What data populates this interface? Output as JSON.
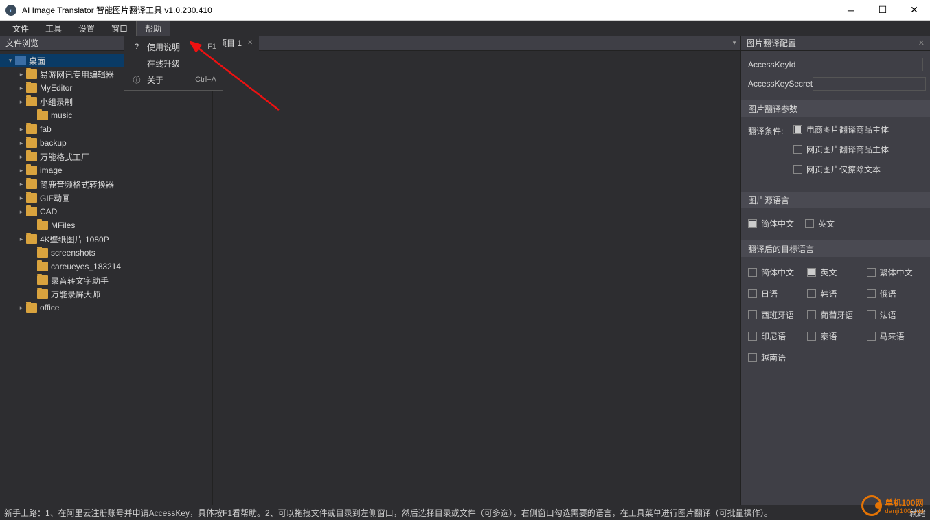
{
  "title": "AI Image Translator 智能图片翻译工具 v1.0.230.410",
  "menu": {
    "items": [
      "文件",
      "工具",
      "设置",
      "窗口",
      "帮助"
    ],
    "active": 4
  },
  "help_menu": [
    {
      "icon": "?",
      "label": "使用说明",
      "shortcut": "F1"
    },
    {
      "icon": "",
      "label": "在线升级",
      "shortcut": ""
    },
    {
      "icon": "ⓘ",
      "label": "关于",
      "shortcut": "Ctrl+A"
    }
  ],
  "left_panel_title": "文件浏览",
  "tree": [
    {
      "d": 0,
      "exp": "▾",
      "ico": "desktop",
      "lbl": "桌面",
      "sel": true
    },
    {
      "d": 1,
      "exp": "▸",
      "ico": "folder",
      "lbl": "易游网讯专用编辑器"
    },
    {
      "d": 1,
      "exp": "▸",
      "ico": "folder",
      "lbl": "MyEditor"
    },
    {
      "d": 1,
      "exp": "▸",
      "ico": "folder",
      "lbl": "小组录制"
    },
    {
      "d": 2,
      "exp": "",
      "ico": "folder",
      "lbl": "music"
    },
    {
      "d": 1,
      "exp": "▸",
      "ico": "folder",
      "lbl": "fab"
    },
    {
      "d": 1,
      "exp": "▸",
      "ico": "folder",
      "lbl": "backup"
    },
    {
      "d": 1,
      "exp": "▸",
      "ico": "folder",
      "lbl": "万能格式工厂"
    },
    {
      "d": 1,
      "exp": "▸",
      "ico": "folder",
      "lbl": "image"
    },
    {
      "d": 1,
      "exp": "▸",
      "ico": "folder",
      "lbl": "简鹿音频格式转换器"
    },
    {
      "d": 1,
      "exp": "▸",
      "ico": "folder",
      "lbl": "GIF动画"
    },
    {
      "d": 1,
      "exp": "▸",
      "ico": "folder",
      "lbl": "CAD"
    },
    {
      "d": 2,
      "exp": "",
      "ico": "folder",
      "lbl": "MFiles"
    },
    {
      "d": 1,
      "exp": "▸",
      "ico": "folder",
      "lbl": "4K壁纸图片 1080P"
    },
    {
      "d": 2,
      "exp": "",
      "ico": "folder",
      "lbl": "screenshots"
    },
    {
      "d": 2,
      "exp": "",
      "ico": "folder",
      "lbl": "careueyes_183214"
    },
    {
      "d": 2,
      "exp": "",
      "ico": "folder",
      "lbl": "录音转文字助手"
    },
    {
      "d": 2,
      "exp": "",
      "ico": "folder",
      "lbl": "万能录屏大师"
    },
    {
      "d": 1,
      "exp": "▸",
      "ico": "folder",
      "lbl": "office"
    }
  ],
  "tabs": [
    {
      "label": "项目 1",
      "active": true
    }
  ],
  "right": {
    "title": "图片翻译配置",
    "fields": {
      "accesskeyid": "AccessKeyId",
      "accesskeysecret": "AccessKeySecret"
    },
    "section_params": "图片翻译参数",
    "cond_label": "翻译条件:",
    "cond_opts": [
      {
        "lbl": "电商图片翻译商品主体",
        "checked": true
      },
      {
        "lbl": "网页图片翻译商品主体",
        "checked": false
      },
      {
        "lbl": "网页图片仅擦除文本",
        "checked": false
      }
    ],
    "section_src": "图片源语言",
    "src_opts": [
      {
        "lbl": "简体中文",
        "checked": true
      },
      {
        "lbl": "英文",
        "checked": false
      }
    ],
    "section_tgt": "翻译后的目标语言",
    "tgt_opts": [
      {
        "lbl": "简体中文",
        "checked": false
      },
      {
        "lbl": "英文",
        "checked": true
      },
      {
        "lbl": "繁体中文",
        "checked": false
      },
      {
        "lbl": "日语",
        "checked": false
      },
      {
        "lbl": "韩语",
        "checked": false
      },
      {
        "lbl": "俄语",
        "checked": false
      },
      {
        "lbl": "西班牙语",
        "checked": false
      },
      {
        "lbl": "葡萄牙语",
        "checked": false
      },
      {
        "lbl": "法语",
        "checked": false
      },
      {
        "lbl": "印尼语",
        "checked": false
      },
      {
        "lbl": "泰语",
        "checked": false
      },
      {
        "lbl": "马来语",
        "checked": false
      },
      {
        "lbl": "越南语",
        "checked": false
      }
    ]
  },
  "status": {
    "left": "新手上路：1、在阿里云注册账号并申请AccessKey，具体按F1看帮助。2、可以拖拽文件或目录到左侧窗口，然后选择目录或文件（可多选），右侧窗口勾选需要的语言，在工具菜单进行图片翻译（可批量操作）。",
    "right": "就绪"
  },
  "watermark": {
    "line1": "单机100网",
    "line2": "danji100.com"
  }
}
